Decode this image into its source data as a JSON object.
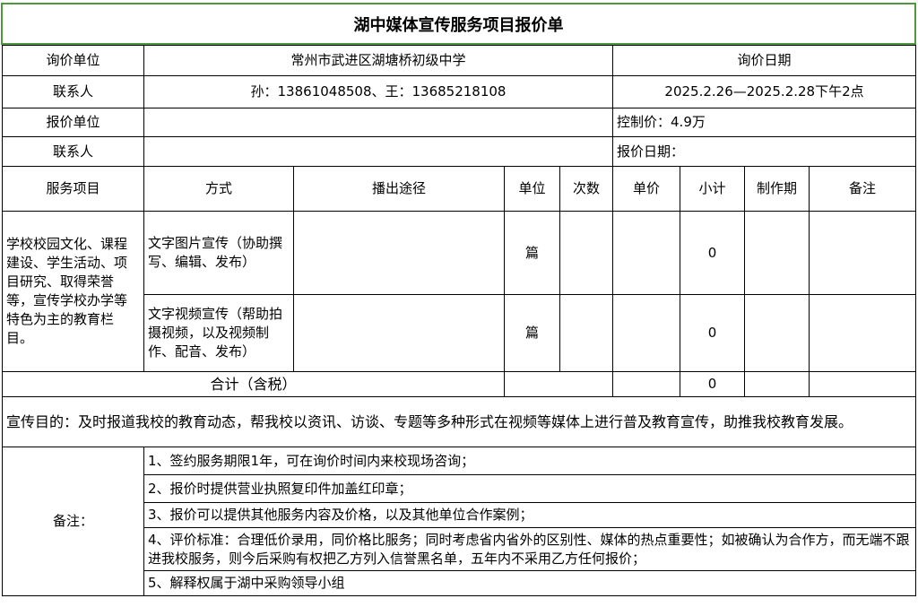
{
  "title": "湖中媒体宣传服务项目报价单",
  "header": {
    "inquiry_unit_label": "询价单位",
    "inquiry_unit_value": "常州市武进区湖塘桥初级中学",
    "inquiry_date_label": "询价日期",
    "contact_label": "联系人",
    "contact_value": "孙：13861048508、王：13685218108",
    "date_value": "2025.2.26—2025.2.28下午2点",
    "quote_unit_label": "报价单位",
    "control_price": "控制价：4.9万",
    "contact2_label": "联系人",
    "quote_date_label": "报价日期："
  },
  "columns": [
    "服务项目",
    "方式",
    "播出途径",
    "单位",
    "次数",
    "单价",
    "小计",
    "制作期",
    "备注"
  ],
  "service_item": "学校校园文化、课程建设、学生活动、项目研究、取得荣誉等，宣传学校办学等特色为主的教育栏目。",
  "rows": [
    {
      "method": "文字图片宣传（协助撰写、编辑、发布）",
      "unit": "篇",
      "subtotal": "0"
    },
    {
      "method": "文字视频宣传（帮助拍摄视频，以及视频制作、配音、发布）",
      "unit": "篇",
      "subtotal": "0"
    }
  ],
  "total_label": "合计（含税）",
  "total_value": "0",
  "purpose": "宣传目的：及时报道我校的教育动态，帮我校以资讯、访谈、专题等多种形式在视频等媒体上进行普及教育宣传，助推我校教育发展。",
  "notes_label": "备注：",
  "notes": [
    "1、签约服务期限1年，可在询价时间内来校现场咨询；",
    "2、报价时提供营业执照复印件加盖红印章；",
    "3、报价可以提供其他服务内容及价格，以及其他单位合作案例；",
    "4、评价标准：合理低价录用，同价格比服务；同时考虑省内省外的区别性、媒体的热点重要性；如被确认为合作方，而无端不跟进我校服务，则今后采购有权把乙方列入信誉黑名单，五年内不采用乙方任何报价；",
    "5、解释权属于湖中采购领导小组"
  ]
}
